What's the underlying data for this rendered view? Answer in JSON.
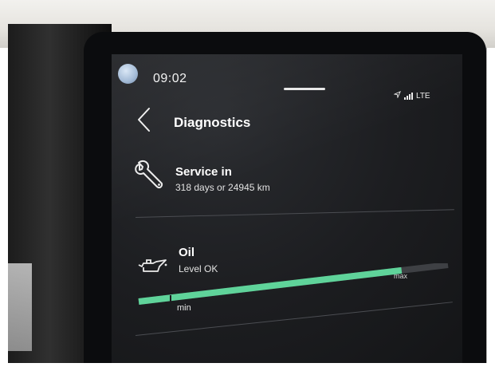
{
  "status_bar": {
    "time": "09:02",
    "network": "LTE",
    "icons": [
      "avatar",
      "location-arrow-icon",
      "signal-bars-icon"
    ]
  },
  "header": {
    "back_icon": "chevron-left-icon",
    "title": "Diagnostics"
  },
  "service": {
    "icon": "wrench-icon",
    "title": "Service in",
    "detail": "318 days or 24945 km"
  },
  "oil": {
    "icon": "oil-can-icon",
    "title": "Oil",
    "status": "Level OK",
    "gauge": {
      "min_label": "min",
      "max_label": "max",
      "level_fraction": 0.85
    }
  },
  "colors": {
    "accent": "#5fd39a",
    "background": "#1c1d20",
    "text": "#ffffff"
  }
}
